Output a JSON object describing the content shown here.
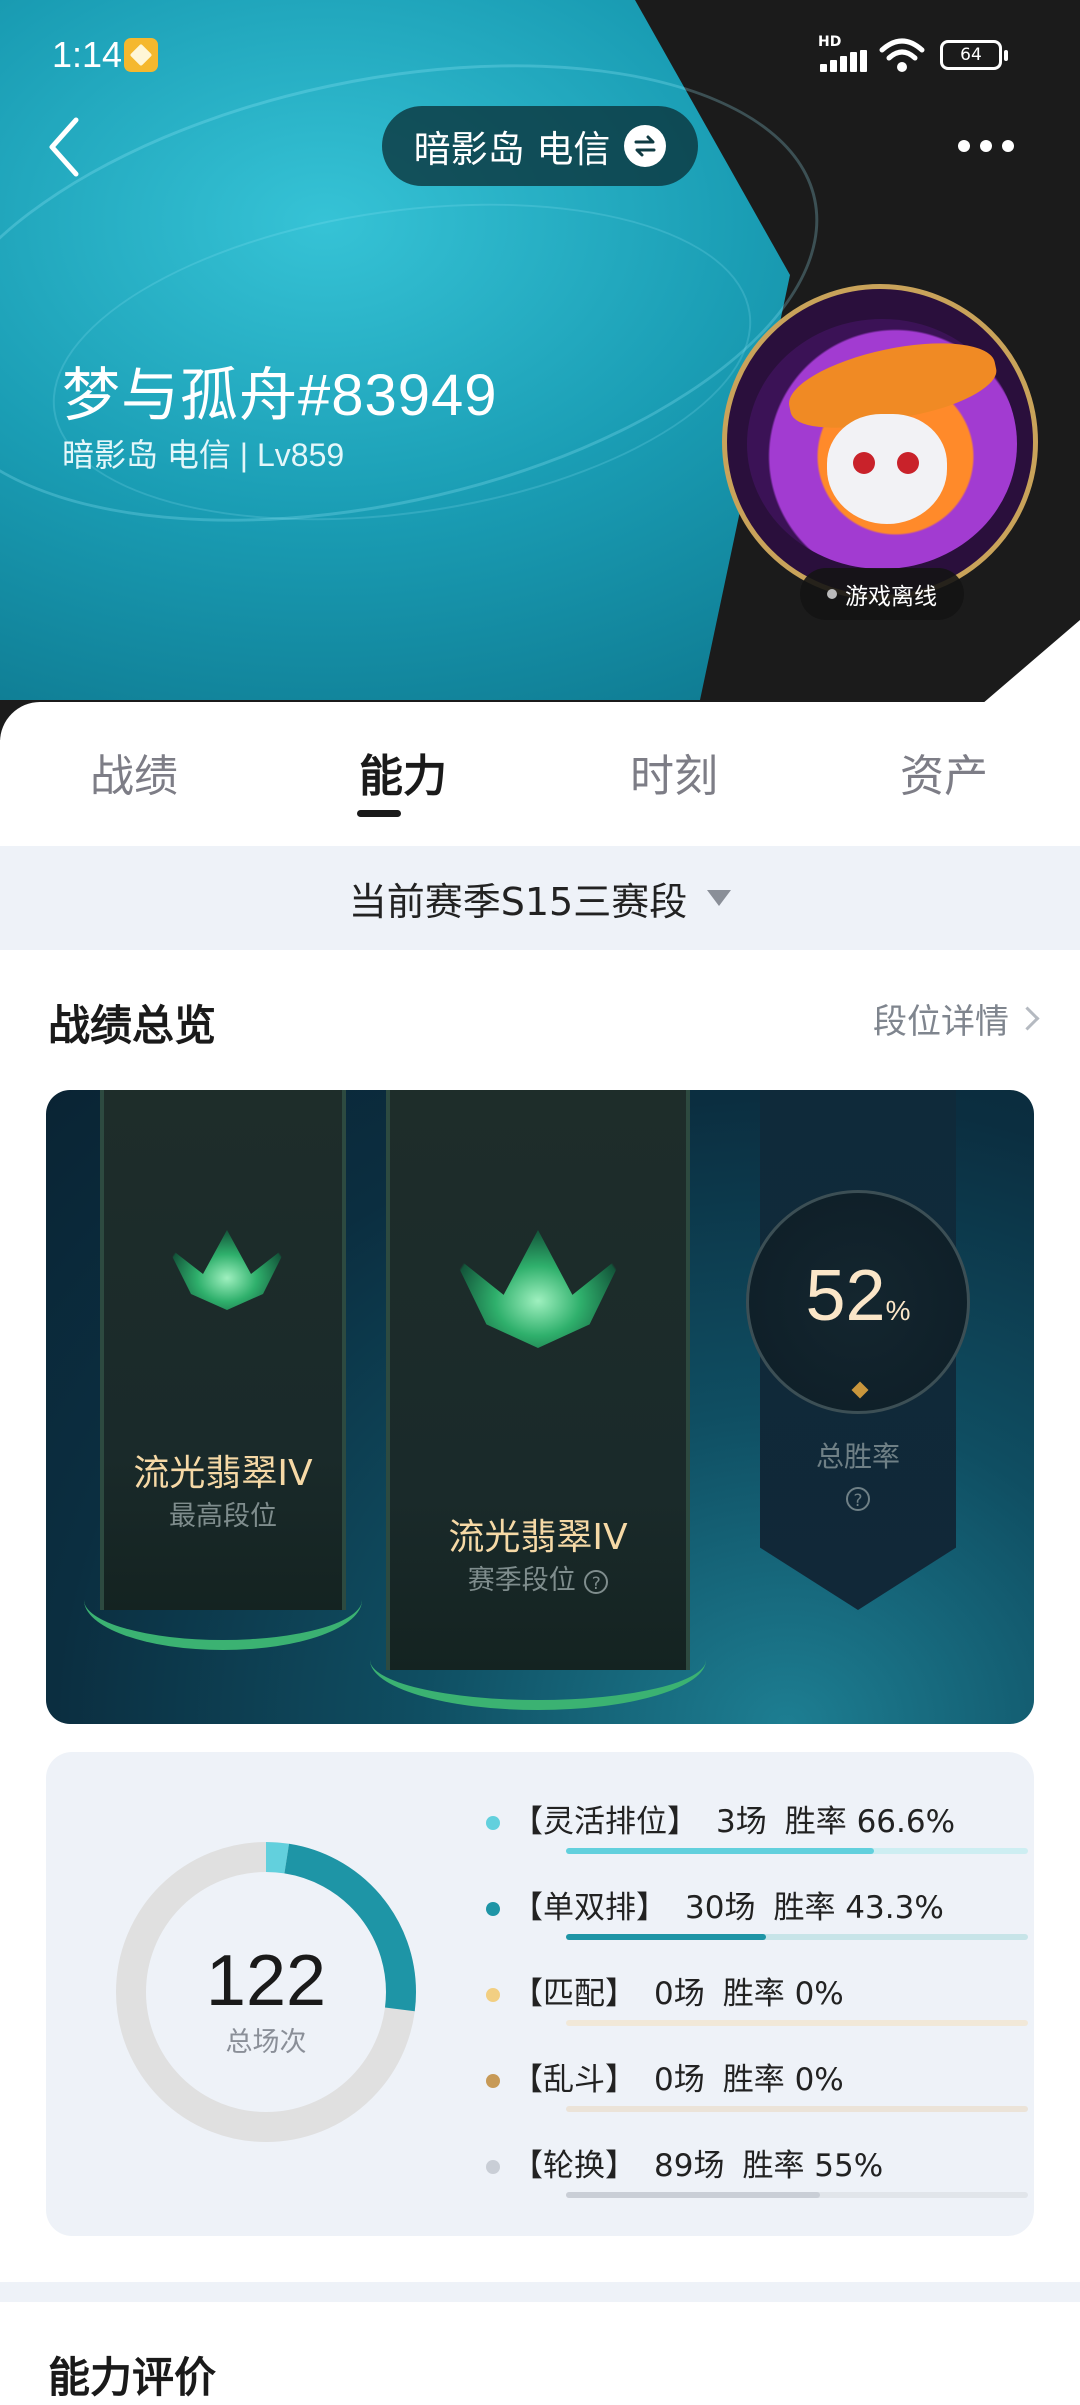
{
  "status_bar": {
    "time": "1:14",
    "battery": "64",
    "network": "HD"
  },
  "header": {
    "server": "暗影岛 电信",
    "player_name": "梦与孤舟#83949",
    "player_sub": "暗影岛 电信 | Lv859",
    "status": "游戏离线",
    "icons": [
      "back-arrow-icon",
      "swap-icon",
      "more-icon"
    ]
  },
  "tabs": [
    {
      "label": "战绩",
      "active": false
    },
    {
      "label": "能力",
      "active": true
    },
    {
      "label": "时刻",
      "active": false
    },
    {
      "label": "资产",
      "active": false
    }
  ],
  "season": {
    "label": "当前赛季S15三赛段"
  },
  "overview": {
    "title": "战绩总览",
    "detail_link": "段位详情",
    "highest_rank": {
      "name": "流光翡翠IV",
      "label": "最高段位"
    },
    "season_rank": {
      "name": "流光翡翠IV",
      "label": "赛季段位"
    },
    "win_rate": {
      "value": "52",
      "unit": "%",
      "label": "总胜率"
    }
  },
  "stats": {
    "total": "122",
    "total_label": "总场次",
    "modes": [
      {
        "name": "【灵活排位】",
        "games": "3场",
        "rate": "胜率 66.6%",
        "games_n": 3,
        "rate_n": 0.666,
        "color": "#62d0dd",
        "track": "#cdeef2"
      },
      {
        "name": "【单双排】",
        "games": "30场",
        "rate": "胜率 43.3%",
        "games_n": 30,
        "rate_n": 0.433,
        "color": "#1e95a6",
        "track": "#c7e4e8"
      },
      {
        "name": "【匹配】",
        "games": "0场",
        "rate": "胜率 0%",
        "games_n": 0,
        "rate_n": 0,
        "color": "#f2cf82",
        "track": "#f1e8d8"
      },
      {
        "name": "【乱斗】",
        "games": "0场",
        "rate": "胜率 0%",
        "games_n": 0,
        "rate_n": 0,
        "color": "#c79a57",
        "track": "#ebe3d8"
      },
      {
        "name": "【轮换】",
        "games": "89场",
        "rate": "胜率 55%",
        "games_n": 89,
        "rate_n": 0.55,
        "color": "#c9ced6",
        "track": "#e1e5ea"
      }
    ]
  },
  "ability": {
    "title": "能力评价"
  }
}
